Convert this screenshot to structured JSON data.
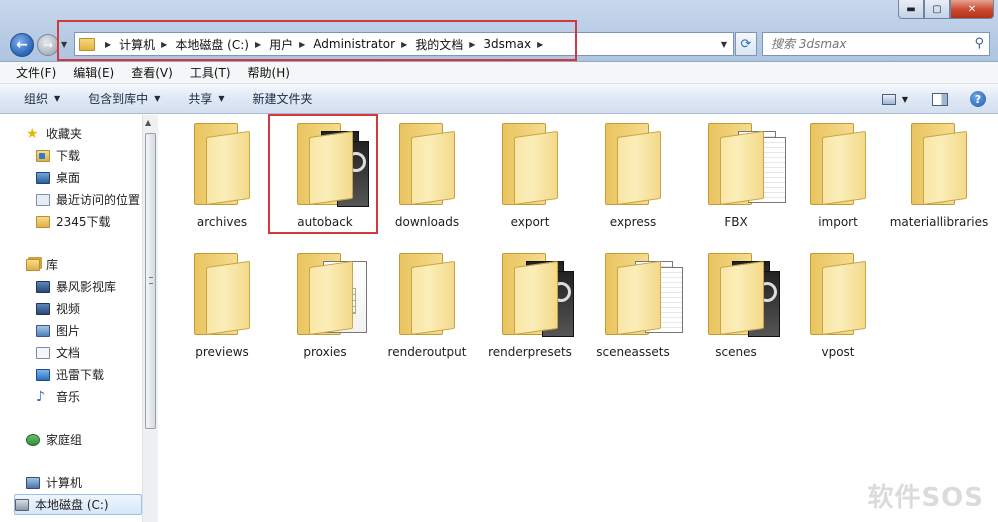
{
  "window": {
    "min_glyph": "▬",
    "max_glyph": "▢",
    "close_glyph": "✕"
  },
  "address": {
    "crumbs": [
      "计算机",
      "本地磁盘 (C:)",
      "用户",
      "Administrator",
      "我的文档",
      "3dsmax"
    ]
  },
  "search": {
    "placeholder": "搜索 3dsmax"
  },
  "menu": [
    "文件(F)",
    "编辑(E)",
    "查看(V)",
    "工具(T)",
    "帮助(H)"
  ],
  "commands": [
    {
      "label": "组织",
      "has_arrow": true
    },
    {
      "label": "包含到库中",
      "has_arrow": true
    },
    {
      "label": "共享",
      "has_arrow": true
    },
    {
      "label": "新建文件夹",
      "has_arrow": false
    }
  ],
  "sidebar": {
    "favorites": {
      "label": "收藏夹",
      "items": [
        "下载",
        "桌面",
        "最近访问的位置",
        "2345下载"
      ]
    },
    "libraries": {
      "label": "库",
      "items": [
        "暴风影视库",
        "视频",
        "图片",
        "文档",
        "迅雷下载",
        "音乐"
      ]
    },
    "homegroup": {
      "label": "家庭组"
    },
    "computer": {
      "label": "计算机",
      "items": [
        "本地磁盘 (C:)"
      ]
    }
  },
  "folders": [
    {
      "name": "archives",
      "content": "none"
    },
    {
      "name": "autoback",
      "content": "max"
    },
    {
      "name": "downloads",
      "content": "none"
    },
    {
      "name": "export",
      "content": "none"
    },
    {
      "name": "express",
      "content": "none"
    },
    {
      "name": "FBX",
      "content": "paper"
    },
    {
      "name": "import",
      "content": "none"
    },
    {
      "name": "materiallibraries",
      "content": "none"
    },
    {
      "name": "previews",
      "content": "none"
    },
    {
      "name": "proxies",
      "content": "sheet"
    },
    {
      "name": "renderoutput",
      "content": "none"
    },
    {
      "name": "renderpresets",
      "content": "ps"
    },
    {
      "name": "sceneassets",
      "content": "paper"
    },
    {
      "name": "scenes",
      "content": "max"
    },
    {
      "name": "vpost",
      "content": "none"
    }
  ],
  "highlight": {
    "color": "#d2383c"
  },
  "watermark": "软件SOS"
}
